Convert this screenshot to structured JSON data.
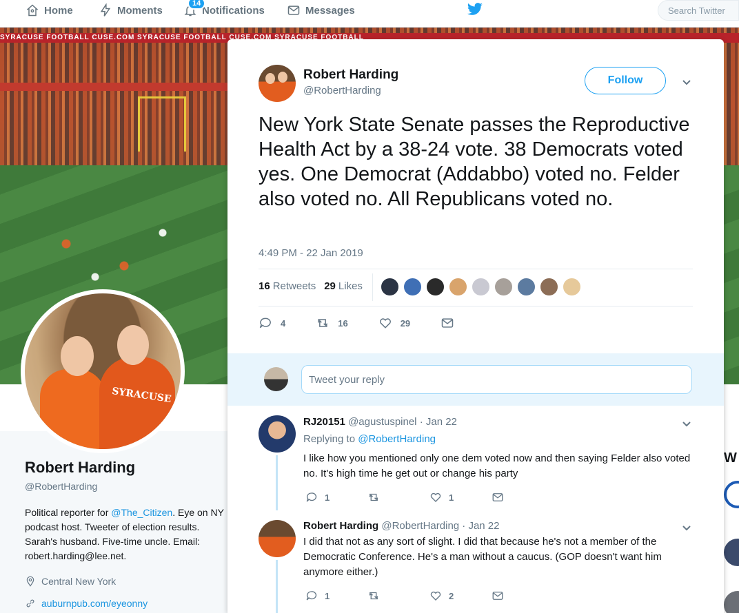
{
  "nav": {
    "home": "Home",
    "moments": "Moments",
    "notifications": "Notifications",
    "notif_count": "14",
    "messages": "Messages",
    "search_placeholder": "Search Twitter"
  },
  "banner": {
    "rail_text": "SYRACUSE FOOTBALL    CUSE.COM    SYRACUSE FOOTBALL    CUSE.COM    SYRACUSE FOOTBALL"
  },
  "profile": {
    "name": "Robert Harding",
    "handle": "@RobertHarding",
    "bio_pre": "Political reporter for ",
    "bio_link": "@The_Citizen",
    "bio_post": ". Eye on NY podcast host. Tweeter of election results. Sarah's husband. Five-time uncle. Email: robert.harding@lee.net.",
    "location": "Central New York",
    "url": "auburnpub.com/eyeonny",
    "avatar_text": "SYRACUSE"
  },
  "tweet": {
    "name": "Robert Harding",
    "handle": "@RobertHarding",
    "follow_label": "Follow",
    "text": "New York State Senate passes the Reproductive Health Act by a 38-24 vote. 38 Democrats voted yes. One Democrat (Addabbo) voted no. Felder also voted no. All Republicans voted no.",
    "time": "4:49 PM - 22 Jan 2019",
    "retweets_count": "16",
    "retweets_label": "Retweets",
    "likes_count": "29",
    "likes_label": "Likes",
    "reply_count": "4",
    "retweet_action_count": "16",
    "like_action_count": "29",
    "liker_colors": [
      "#2b3444",
      "#3f6fb5",
      "#2a2a2a",
      "#d9a46c",
      "#c9c9d2",
      "#a7a09a",
      "#5c7ba0",
      "#8c6d56",
      "#e6c99a"
    ]
  },
  "reply_box": {
    "placeholder": "Tweet your reply"
  },
  "replies": [
    {
      "name": "RJ20151",
      "handle": "@agustuspinel",
      "date": "· Jan 22",
      "replying_prefix": "Replying to ",
      "replying_to": "@RobertHarding",
      "text": "I like how you mentioned only one dem voted now and then saying Felder also voted no. It's high time he get out or change his party",
      "replies": "1",
      "retweets": "",
      "likes": "1"
    },
    {
      "name": "Robert Harding",
      "handle": "@RobertHarding",
      "date": "· Jan 22",
      "text": "I did that not as any sort of slight. I did that because he's not a member of the Democratic Conference. He's a man without a caucus. (GOP doesn't want him anymore either.)",
      "replies": "1",
      "retweets": "",
      "likes": "2"
    }
  ],
  "right_peek": {
    "letter": "W"
  },
  "colors": {
    "accent": "#1da1f2",
    "link": "#1b95e0",
    "orange": "#e2581c"
  }
}
